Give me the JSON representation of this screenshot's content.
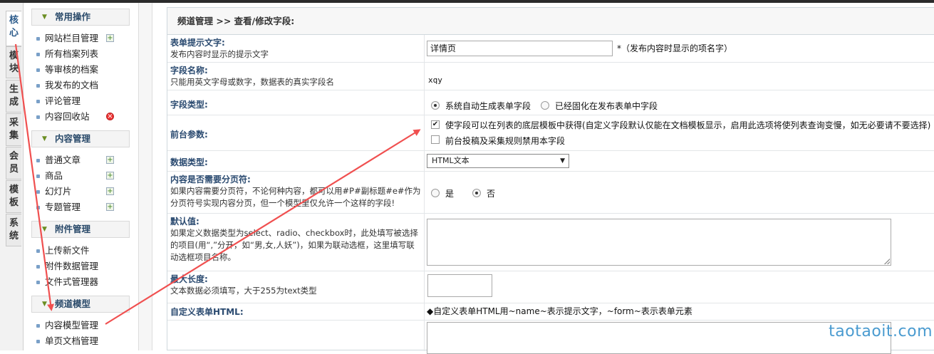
{
  "vtabs": [
    {
      "label": "核心"
    },
    {
      "label": "模块"
    },
    {
      "label": "生成"
    },
    {
      "label": "采集"
    },
    {
      "label": "会员"
    },
    {
      "label": "模板"
    },
    {
      "label": "系统"
    }
  ],
  "sidebar": {
    "groups": [
      {
        "title": "常用操作",
        "items": [
          "网站栏目管理",
          "所有档案列表",
          "等审核的档案",
          "我发布的文档",
          "评论管理",
          "内容回收站"
        ]
      },
      {
        "title": "内容管理",
        "items": [
          "普通文章",
          "商品",
          "幻灯片",
          "专题管理"
        ]
      },
      {
        "title": "附件管理",
        "items": [
          "上传新文件",
          "附件数据管理",
          "文件式管理器"
        ]
      },
      {
        "title": "频道模型",
        "items": [
          "内容模型管理",
          "单页文档管理"
        ]
      }
    ]
  },
  "panel": {
    "title": "频道管理 >> 查看/修改字段:",
    "rows": {
      "itemname": {
        "label": "表单提示文字:",
        "desc": "发布内容时显示的提示文字",
        "value": "详情页",
        "note": "*（发布内容时显示的项名字）"
      },
      "fieldname": {
        "label": "字段名称:",
        "desc": "只能用英文字母或数字，数据表的真实字段名",
        "value": "xqy"
      },
      "fieldtype": {
        "label": "字段类型:",
        "opt1": "系统自动生成表单字段",
        "opt2": "已经固化在发布表单中字段"
      },
      "frontend": {
        "label": "前台参数:",
        "opt1": "使字段可以在列表的底层模板中获得(自定义字段默认仅能在文档模板显示，启用此选项将使列表查询变慢，如无必要请不要选择)",
        "opt2": "前台投稿及采集规则禁用本字段"
      },
      "datatype": {
        "label": "数据类型:",
        "selected": "HTML文本"
      },
      "paging": {
        "label": "内容是否需要分页符:",
        "desc": "如果内容需要分页符，不论何种内容，都可以用#P#副标题#e#作为分页符号实现内容分页，但一个模型里仅允许一个这样的字段!",
        "yes": "是",
        "no": "否"
      },
      "default": {
        "label": "默认值:",
        "desc": "如果定义数据类型为select、radio、checkbox时，此处填写被选择的项目(用“,”分开，如“男,女,人妖”)，如果为联动选框，这里填写联动选框项目名称。"
      },
      "maxlength": {
        "label": "最大长度:",
        "desc": "文本数据必须填写，大于255为text类型",
        "value": ""
      },
      "customhtml": {
        "label": "自定义表单HTML:",
        "note": "◆自定义表单HTML用~name~表示提示文字，~form~表示表单元素"
      }
    }
  },
  "watermark": "taotaoit.com",
  "colors": {
    "annotation": "#f05050",
    "accent": "#2a4a70"
  }
}
